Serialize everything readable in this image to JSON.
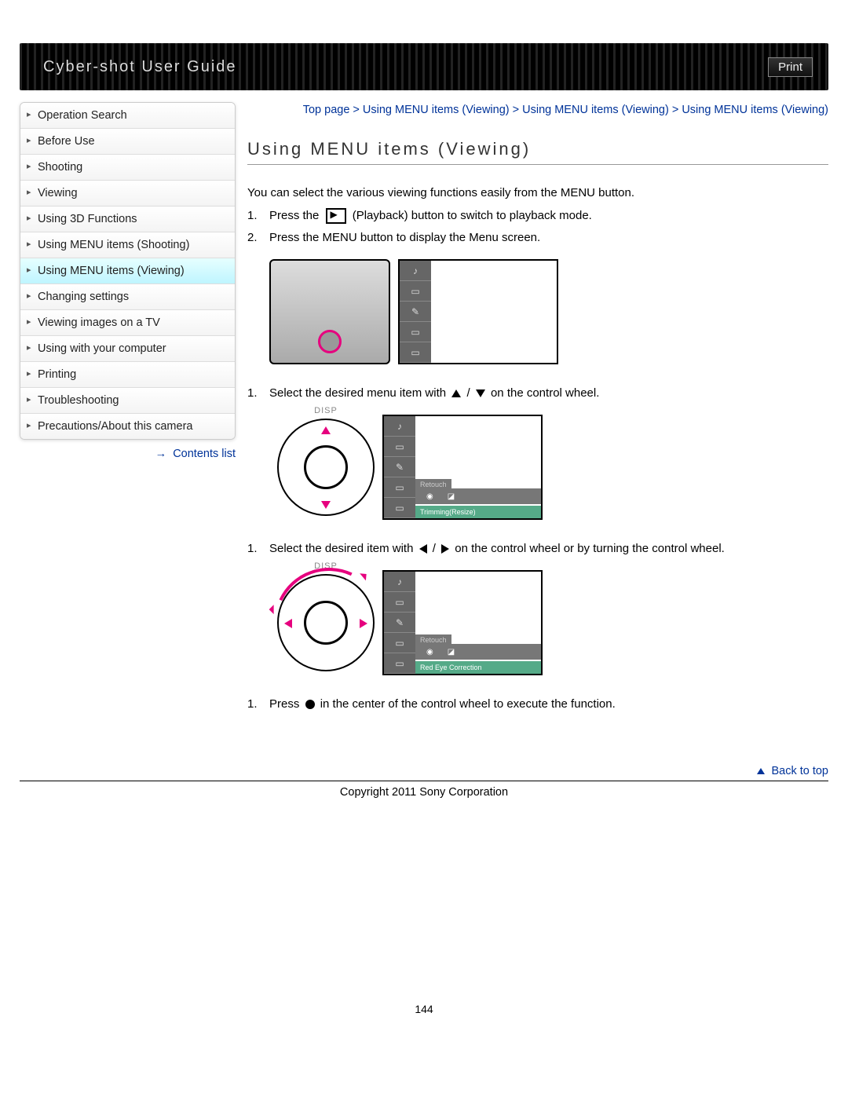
{
  "header": {
    "title": "Cyber-shot User Guide",
    "print": "Print"
  },
  "breadcrumb": {
    "parts": [
      "Top page",
      "Using MENU items (Viewing)",
      "Using MENU items (Viewing)",
      "Using MENU items (Viewing)"
    ],
    "sep": " > "
  },
  "sidebar": {
    "items": [
      "Operation Search",
      "Before Use",
      "Shooting",
      "Viewing",
      "Using 3D Functions",
      "Using MENU items (Shooting)",
      "Using MENU items (Viewing)",
      "Changing settings",
      "Viewing images on a TV",
      "Using with your computer",
      "Printing",
      "Troubleshooting",
      "Precautions/About this camera"
    ],
    "active_index": 6,
    "contents_list": "Contents list"
  },
  "page": {
    "title": "Using MENU items (Viewing)",
    "intro": "You can select the various viewing functions easily from the MENU button.",
    "steps": {
      "s1a": "Press the ",
      "s1b": " (Playback) button to switch to playback mode.",
      "s2": "Press the MENU button to display the Menu screen.",
      "s3a": "Select the desired menu item with ",
      "s3b": " on the control wheel.",
      "s4a": "Select the desired item with ",
      "s4b": " on the control wheel or by turning the control wheel.",
      "s5a": "Press ",
      "s5b": " in the center of the control wheel to execute the function."
    },
    "screen_labels": {
      "retouch": "Retouch",
      "trimming": "Trimming(Resize)",
      "redeye": "Red Eye Correction",
      "disp": "DISP"
    }
  },
  "footer": {
    "back_to_top": "Back to top",
    "copyright": "Copyright 2011 Sony Corporation",
    "page_number": "144"
  }
}
